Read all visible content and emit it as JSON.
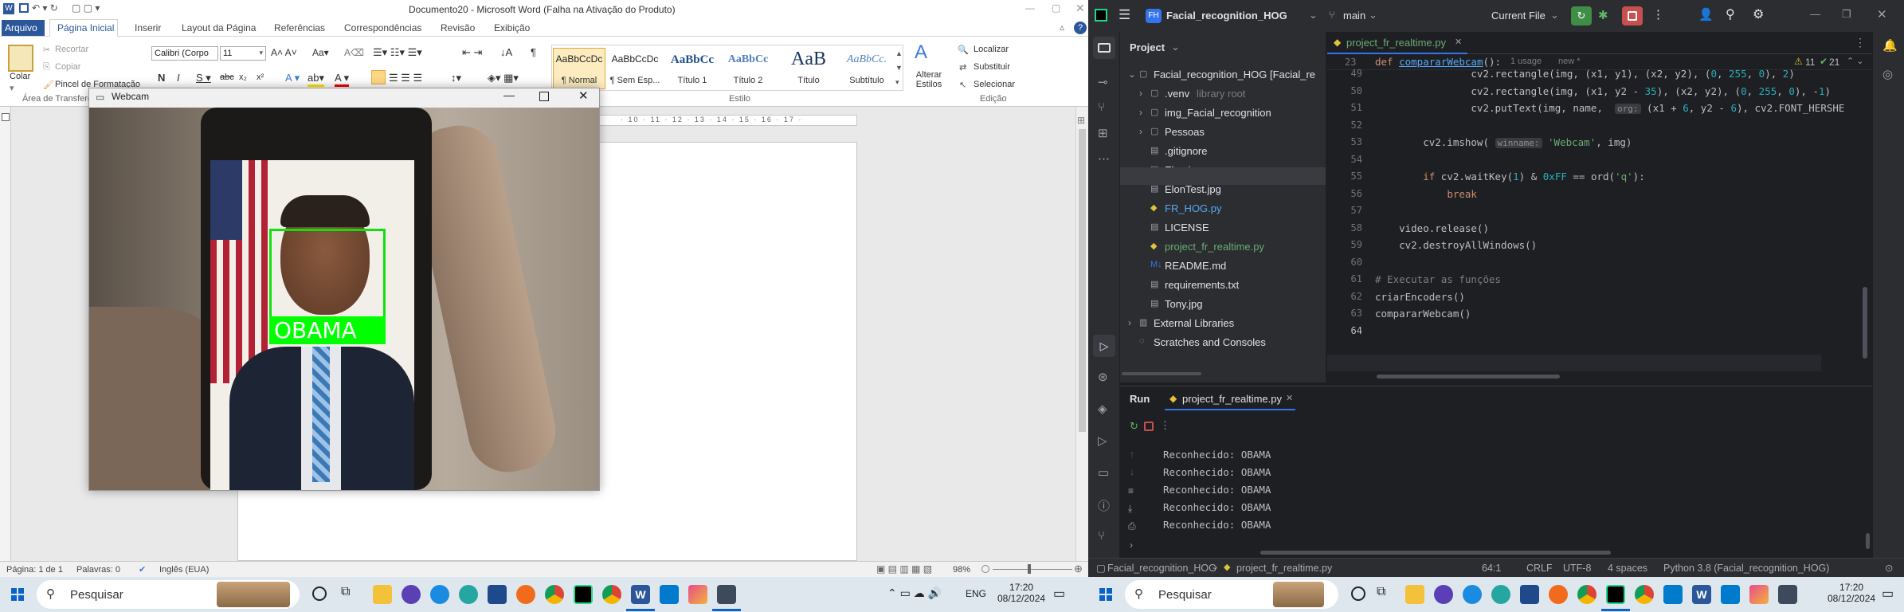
{
  "word": {
    "title": "Documento20 - Microsoft Word (Falha na Ativação do Produto)",
    "tabs": [
      "Arquivo",
      "Página Inicial",
      "Inserir",
      "Layout da Página",
      "Referências",
      "Correspondências",
      "Revisão",
      "Exibição"
    ],
    "clipboard": {
      "paste": "Colar",
      "cut": "Recortar",
      "copy": "Copiar",
      "format_painter": "Pincel de Formatação",
      "group": "Área de Transferência"
    },
    "font": {
      "name": "Calibri (Corpo",
      "size": "11"
    },
    "styles": [
      {
        "preview": "AaBbCcDc",
        "label": "¶ Normal"
      },
      {
        "preview": "AaBbCcDc",
        "label": "¶ Sem Esp..."
      },
      {
        "preview": "AaBbCc",
        "label": "Título 1"
      },
      {
        "preview": "AaBbCc",
        "label": "Título 2"
      },
      {
        "preview": "AaB",
        "label": "Título"
      },
      {
        "preview": "AaBbCc.",
        "label": "Subtítulo"
      }
    ],
    "style_group": "Estilo",
    "change_styles": "Alterar Estilos",
    "editing": {
      "find": "Localizar",
      "replace": "Substituir",
      "select": "Selecionar",
      "group": "Edição"
    },
    "status": {
      "page": "Página: 1 de 1",
      "words": "Palavras: 0",
      "language": "Inglês (EUA)",
      "zoom": "98%"
    }
  },
  "webcam": {
    "title": "Webcam",
    "label": "OBAMA"
  },
  "taskbar_left": {
    "search": "Pesquisar",
    "lang": "ENG",
    "time": "17:20",
    "date": "08/12/2024"
  },
  "pycharm": {
    "project_badge": "FH",
    "project_name": "Facial_recognition_HOG",
    "branch": "main",
    "run_config": "Current File",
    "panel_title": "Project",
    "tree": [
      {
        "label": "Facial_recognition_HOG [Facial_re",
        "type": "root"
      },
      {
        "label": ".venv",
        "extra": "library root",
        "type": "folder"
      },
      {
        "label": "img_Facial_recognition",
        "type": "folder"
      },
      {
        "label": "Pessoas",
        "type": "folder"
      },
      {
        "label": ".gitignore",
        "type": "file"
      },
      {
        "label": "Elon.jpg",
        "type": "file"
      },
      {
        "label": "ElonTest.jpg",
        "type": "file"
      },
      {
        "label": "FR_HOG.py",
        "type": "py"
      },
      {
        "label": "LICENSE",
        "type": "file"
      },
      {
        "label": "project_fr_realtime.py",
        "type": "py"
      },
      {
        "label": "README.md",
        "type": "md"
      },
      {
        "label": "requirements.txt",
        "type": "file"
      },
      {
        "label": "Tony.jpg",
        "type": "file"
      },
      {
        "label": "External Libraries",
        "type": "lib"
      },
      {
        "label": "Scratches and Consoles",
        "type": "scratch"
      }
    ],
    "editor_tab": "project_fr_realtime.py",
    "inspections": {
      "warnings": "11",
      "weak": "21"
    },
    "sticky": {
      "line": "23",
      "def": "def",
      "fn": "compararWebcam",
      "rest": "():",
      "usage": "1 usage",
      "new": "new *"
    },
    "line_numbers": [
      "49",
      "50",
      "51",
      "52",
      "53",
      "54",
      "55",
      "56",
      "57",
      "58",
      "59",
      "60",
      "61",
      "62",
      "63",
      "64"
    ],
    "code_lines": [
      "                cv2.rectangle(img, (x1, y1), (x2, y2), (0, 255, 0), 2)",
      "                cv2.rectangle(img, (x1, y2 - 35), (x2, y2), (0, 255, 0), -1)",
      "                cv2.putText(img, name,  org: (x1 + 6, y2 - 6), cv2.FONT_HERSHE",
      "",
      "        cv2.imshow( winname: 'Webcam', img)",
      "",
      "        if cv2.waitKey(1) & 0xFF == ord('q'):",
      "            break",
      "",
      "    video.release()",
      "    cv2.destroyAllWindows()",
      "",
      "# Executar as funções",
      "criarEncoders()",
      "compararWebcam()",
      ""
    ],
    "run_tab": "Run",
    "run_file": "project_fr_realtime.py",
    "output": [
      "Reconhecido: OBAMA",
      "Reconhecido: OBAMA",
      "Reconhecido: OBAMA",
      "Reconhecido: OBAMA",
      "Reconhecido: OBAMA"
    ],
    "status": {
      "breadcrumb_project": "Facial_recognition_HOG",
      "breadcrumb_file": "project_fr_realtime.py",
      "position": "64:1",
      "line_sep": "CRLF",
      "encoding": "UTF-8",
      "indent": "4 spaces",
      "interpreter": "Python 3.8 (Facial_recognition_HOG)"
    }
  },
  "taskbar_right": {
    "search": "Pesquisar",
    "time": "17:20",
    "date": "08/12/2024"
  }
}
